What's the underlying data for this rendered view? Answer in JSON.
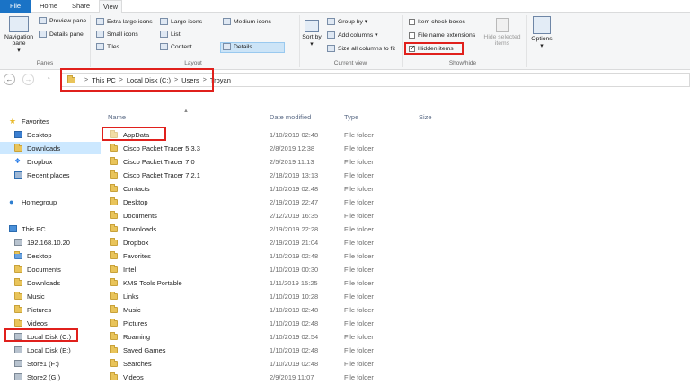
{
  "tabs": {
    "file": "File",
    "home": "Home",
    "share": "Share",
    "view": "View"
  },
  "ribbon": {
    "panes": {
      "navigation_pane": "Navigation pane",
      "navigation_pane_arrow": "▾",
      "preview_pane": "Preview pane",
      "details_pane": "Details pane",
      "label": "Panes"
    },
    "layout": {
      "extra_large_icons": "Extra large icons",
      "large_icons": "Large icons",
      "medium_icons": "Medium icons",
      "small_icons": "Small icons",
      "list": "List",
      "details": "Details",
      "tiles": "Tiles",
      "content": "Content",
      "label": "Layout"
    },
    "current_view": {
      "sort_by": "Sort by",
      "sort_by_arrow": "▾",
      "group_by": "Group by ▾",
      "add_columns": "Add columns ▾",
      "size_all_columns": "Size all columns to fit",
      "label": "Current view"
    },
    "show_hide": {
      "item_check_boxes": "Item check boxes",
      "file_name_extensions": "File name extensions",
      "hidden_items": "Hidden items",
      "hide_selected_items": "Hide selected items",
      "label": "Show/hide"
    },
    "options": {
      "label": "Options",
      "arrow": "▾"
    }
  },
  "address": {
    "back": "←",
    "forward": "→",
    "up": "↑",
    "crumbs": [
      "This PC",
      "Local Disk (C:)",
      "Users",
      "Troyan"
    ],
    "separator": ">"
  },
  "nav": {
    "favorites": "Favorites",
    "desktop": "Desktop",
    "downloads": "Downloads",
    "dropbox": "Dropbox",
    "recent_places": "Recent places",
    "homegroup": "Homegroup",
    "this_pc": "This PC",
    "ip": "192.168.10.20",
    "pc_desktop": "Desktop",
    "documents": "Documents",
    "pc_downloads": "Downloads",
    "music": "Music",
    "pictures": "Pictures",
    "videos": "Videos",
    "local_c": "Local Disk (C:)",
    "local_e": "Local Disk (E:)",
    "store1": "Store1 (F:)",
    "store2": "Store2 (G:)"
  },
  "columns": {
    "name": "Name",
    "date": "Date modified",
    "type": "Type",
    "size": "Size"
  },
  "files": [
    {
      "name": "AppData",
      "date": "1/10/2019 02:48",
      "type": "File folder"
    },
    {
      "name": "Cisco Packet Tracer 5.3.3",
      "date": "2/8/2019 12:38",
      "type": "File folder"
    },
    {
      "name": "Cisco Packet Tracer 7.0",
      "date": "2/5/2019 11:13",
      "type": "File folder"
    },
    {
      "name": "Cisco Packet Tracer 7.2.1",
      "date": "2/18/2019 13:13",
      "type": "File folder"
    },
    {
      "name": "Contacts",
      "date": "1/10/2019 02:48",
      "type": "File folder"
    },
    {
      "name": "Desktop",
      "date": "2/19/2019 22:47",
      "type": "File folder"
    },
    {
      "name": "Documents",
      "date": "2/12/2019 16:35",
      "type": "File folder"
    },
    {
      "name": "Downloads",
      "date": "2/19/2019 22:28",
      "type": "File folder"
    },
    {
      "name": "Dropbox",
      "date": "2/19/2019 21:04",
      "type": "File folder"
    },
    {
      "name": "Favorites",
      "date": "1/10/2019 02:48",
      "type": "File folder"
    },
    {
      "name": "Intel",
      "date": "1/10/2019 00:30",
      "type": "File folder"
    },
    {
      "name": "KMS Tools Portable",
      "date": "1/11/2019 15:25",
      "type": "File folder"
    },
    {
      "name": "Links",
      "date": "1/10/2019 10:28",
      "type": "File folder"
    },
    {
      "name": "Music",
      "date": "1/10/2019 02:48",
      "type": "File folder"
    },
    {
      "name": "Pictures",
      "date": "1/10/2019 02:48",
      "type": "File folder"
    },
    {
      "name": "Roaming",
      "date": "1/10/2019 02:54",
      "type": "File folder"
    },
    {
      "name": "Saved Games",
      "date": "1/10/2019 02:48",
      "type": "File folder"
    },
    {
      "name": "Searches",
      "date": "1/10/2019 02:48",
      "type": "File folder"
    },
    {
      "name": "Videos",
      "date": "2/9/2019 11:07",
      "type": "File folder"
    }
  ],
  "colors": {
    "accent": "#1a73c6",
    "highlight_box": "#e0201c",
    "selection": "#cce8ff",
    "folder": "#e9c45a"
  }
}
